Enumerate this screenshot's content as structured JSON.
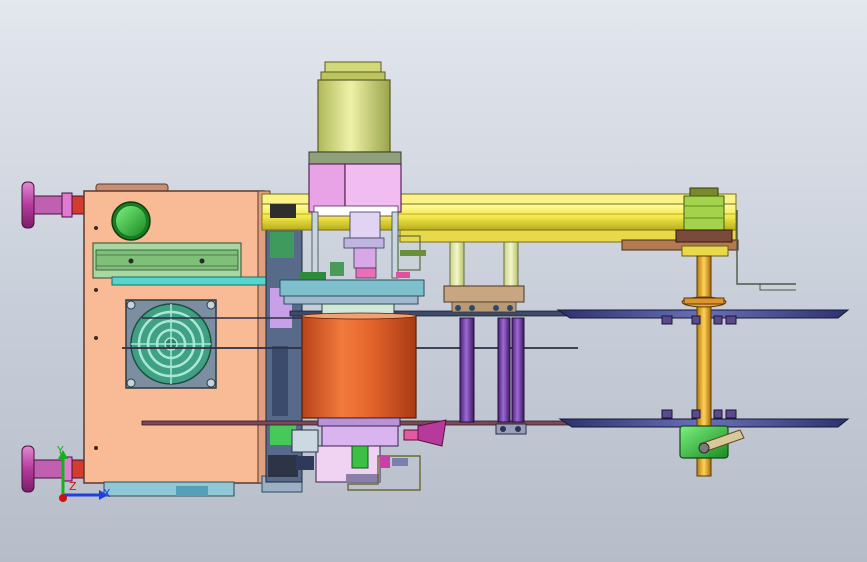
{
  "scene": {
    "kind": "cad-assembly-view",
    "background": {
      "top": "#e3e7ee",
      "bottom": "#b6bdc9"
    }
  },
  "triad": {
    "x_label": "X",
    "y_label": "Y",
    "z_label": "Z",
    "x_color": "#1f3fe0",
    "y_color": "#18b01a",
    "z_color": "#d01010"
  },
  "colors": {
    "housing": "#f8bb96",
    "motor": "#d6e08a",
    "coupling_block": "#e7a3e6",
    "rail": "#f2e84a",
    "drum": "#e0622a",
    "plate": "#4a5095",
    "rod": "#6a33a8",
    "shaft": "#e9a41a",
    "fan": "#49a58a",
    "knob": "#b63a9c",
    "green": "#2ec23a"
  },
  "components": [
    "fan-icon",
    "motor-icon",
    "drum-icon",
    "pulley-icon",
    "knob-icon",
    "rail-icon",
    "shaft-icon",
    "rod-icon"
  ]
}
